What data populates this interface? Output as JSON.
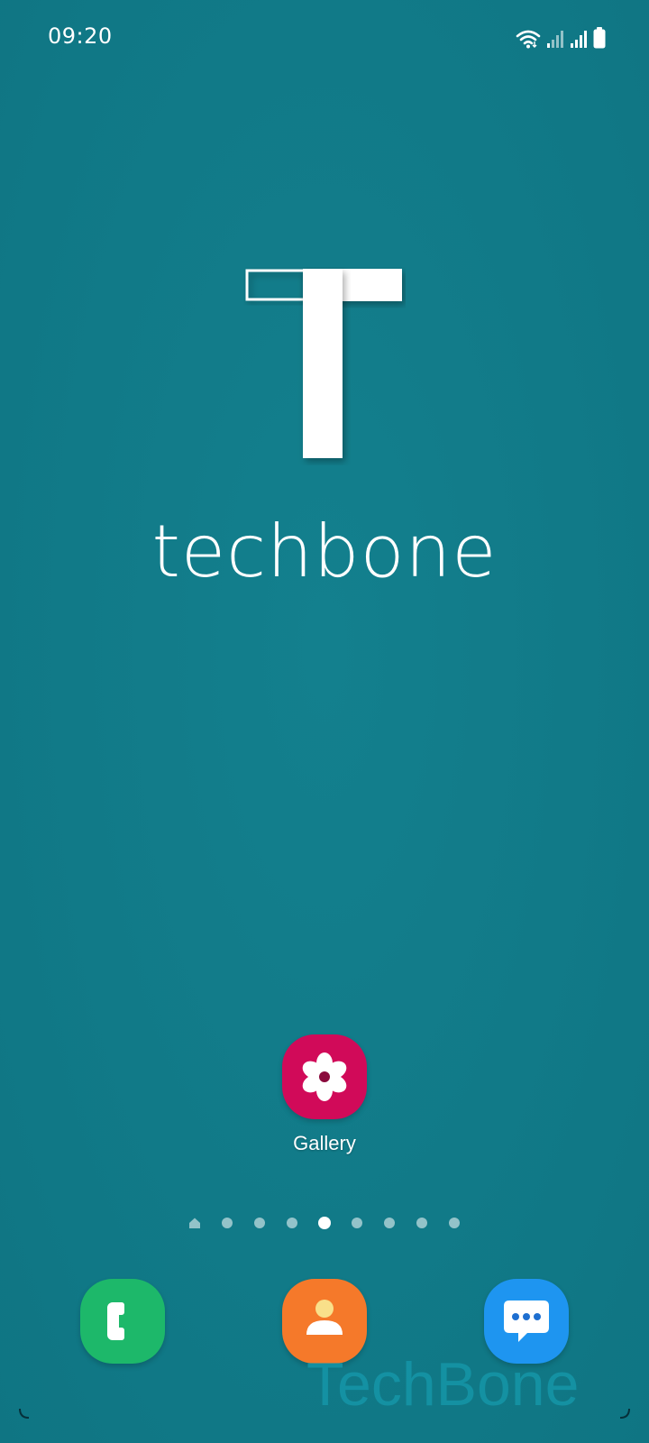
{
  "status_bar": {
    "time": "09:20",
    "icons": [
      "wifi-icon",
      "signal-1-icon",
      "signal-2-icon",
      "battery-icon"
    ]
  },
  "wallpaper": {
    "logo_icon": "techbone-t-logo",
    "brand_text": "techbone"
  },
  "home_apps": [
    {
      "label": "Gallery",
      "icon": "gallery-flower-icon",
      "color": "#d10a59"
    }
  ],
  "page_indicator": {
    "total": 9,
    "has_home_page": true,
    "active_index": 4
  },
  "dock": [
    {
      "name": "phone",
      "icon": "phone-icon",
      "color": "#1db86a"
    },
    {
      "name": "contacts",
      "icon": "contacts-icon",
      "color": "#f5792a"
    },
    {
      "name": "messages",
      "icon": "messages-icon",
      "color": "#1e95f0"
    }
  ],
  "watermark": "TechBone",
  "colors": {
    "wallpaper": "#117a88",
    "accent_white": "#ffffff"
  }
}
